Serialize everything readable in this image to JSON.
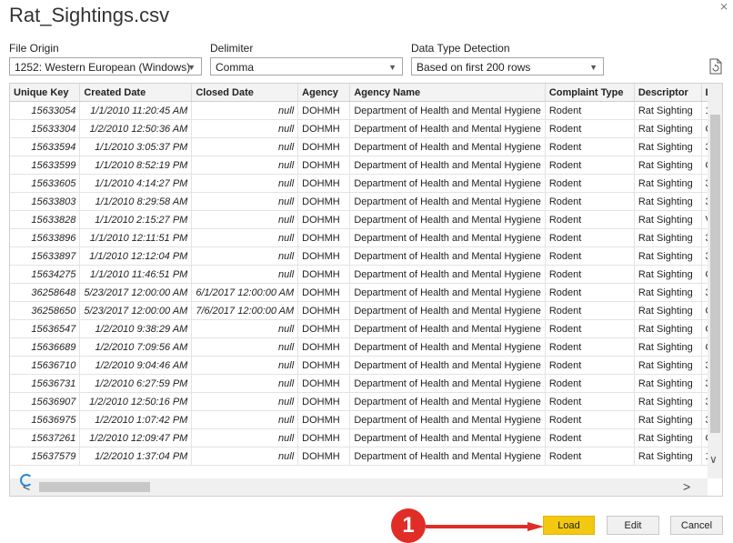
{
  "window": {
    "title": "Rat_Sightings.csv",
    "close_glyph": "⨯"
  },
  "options": {
    "file_origin": {
      "label": "File Origin",
      "value": "1252: Western European (Windows)"
    },
    "delimiter": {
      "label": "Delimiter",
      "value": "Comma"
    },
    "data_type_detection": {
      "label": "Data Type Detection",
      "value": "Based on first 200 rows"
    }
  },
  "table": {
    "headers": [
      "Unique Key",
      "Created Date",
      "Closed Date",
      "Agency",
      "Agency Name",
      "Complaint Type",
      "Descriptor",
      "Lo"
    ],
    "rows": [
      [
        "15633054",
        "1/1/2010 11:20:45 AM",
        "null",
        "DOHMH",
        "Department of Health and Mental Hygiene",
        "Rodent",
        "Rat Sighting",
        "1"
      ],
      [
        "15633304",
        "1/2/2010 12:50:36 AM",
        "null",
        "DOHMH",
        "Department of Health and Mental Hygiene",
        "Rodent",
        "Rat Sighting",
        "C"
      ],
      [
        "15633594",
        "1/1/2010 3:05:37 PM",
        "null",
        "DOHMH",
        "Department of Health and Mental Hygiene",
        "Rodent",
        "Rat Sighting",
        "3"
      ],
      [
        "15633599",
        "1/1/2010 8:52:19 PM",
        "null",
        "DOHMH",
        "Department of Health and Mental Hygiene",
        "Rodent",
        "Rat Sighting",
        "O"
      ],
      [
        "15633605",
        "1/1/2010 4:14:27 PM",
        "null",
        "DOHMH",
        "Department of Health and Mental Hygiene",
        "Rodent",
        "Rat Sighting",
        "3"
      ],
      [
        "15633803",
        "1/1/2010 8:29:58 AM",
        "null",
        "DOHMH",
        "Department of Health and Mental Hygiene",
        "Rodent",
        "Rat Sighting",
        "3"
      ],
      [
        "15633828",
        "1/1/2010 2:15:27 PM",
        "null",
        "DOHMH",
        "Department of Health and Mental Hygiene",
        "Rodent",
        "Rat Sighting",
        "V"
      ],
      [
        "15633896",
        "1/1/2010 12:11:51 PM",
        "null",
        "DOHMH",
        "Department of Health and Mental Hygiene",
        "Rodent",
        "Rat Sighting",
        "3"
      ],
      [
        "15633897",
        "1/1/2010 12:12:04 PM",
        "null",
        "DOHMH",
        "Department of Health and Mental Hygiene",
        "Rodent",
        "Rat Sighting",
        "3"
      ],
      [
        "15634275",
        "1/1/2010 11:46:51 PM",
        "null",
        "DOHMH",
        "Department of Health and Mental Hygiene",
        "Rodent",
        "Rat Sighting",
        "C"
      ],
      [
        "36258648",
        "5/23/2017 12:00:00 AM",
        "6/1/2017 12:00:00 AM",
        "DOHMH",
        "Department of Health and Mental Hygiene",
        "Rodent",
        "Rat Sighting",
        "3"
      ],
      [
        "36258650",
        "5/23/2017 12:00:00 AM",
        "7/6/2017 12:00:00 AM",
        "DOHMH",
        "Department of Health and Mental Hygiene",
        "Rodent",
        "Rat Sighting",
        "C"
      ],
      [
        "15636547",
        "1/2/2010 9:38:29 AM",
        "null",
        "DOHMH",
        "Department of Health and Mental Hygiene",
        "Rodent",
        "Rat Sighting",
        "O"
      ],
      [
        "15636689",
        "1/2/2010 7:09:56 AM",
        "null",
        "DOHMH",
        "Department of Health and Mental Hygiene",
        "Rodent",
        "Rat Sighting",
        "C"
      ],
      [
        "15636710",
        "1/2/2010 9:04:46 AM",
        "null",
        "DOHMH",
        "Department of Health and Mental Hygiene",
        "Rodent",
        "Rat Sighting",
        "3"
      ],
      [
        "15636731",
        "1/2/2010 6:27:59 PM",
        "null",
        "DOHMH",
        "Department of Health and Mental Hygiene",
        "Rodent",
        "Rat Sighting",
        "3"
      ],
      [
        "15636907",
        "1/2/2010 12:50:16 PM",
        "null",
        "DOHMH",
        "Department of Health and Mental Hygiene",
        "Rodent",
        "Rat Sighting",
        "3"
      ],
      [
        "15636975",
        "1/2/2010 1:07:42 PM",
        "null",
        "DOHMH",
        "Department of Health and Mental Hygiene",
        "Rodent",
        "Rat Sighting",
        "3"
      ],
      [
        "15637261",
        "1/2/2010 12:09:47 PM",
        "null",
        "DOHMH",
        "Department of Health and Mental Hygiene",
        "Rodent",
        "Rat Sighting",
        "G"
      ],
      [
        "15637579",
        "1/2/2010 1:37:04 PM",
        "null",
        "DOHMH",
        "Department of Health and Mental Hygiene",
        "Rodent",
        "Rat Sighting",
        "1"
      ]
    ]
  },
  "buttons": {
    "load": "Load",
    "edit": "Edit",
    "cancel": "Cancel"
  },
  "annotation": {
    "step_number": "1"
  },
  "colors": {
    "load_button": "#f2c811",
    "annotation_red": "#e02d27",
    "spinner_blue": "#2b88d8"
  }
}
